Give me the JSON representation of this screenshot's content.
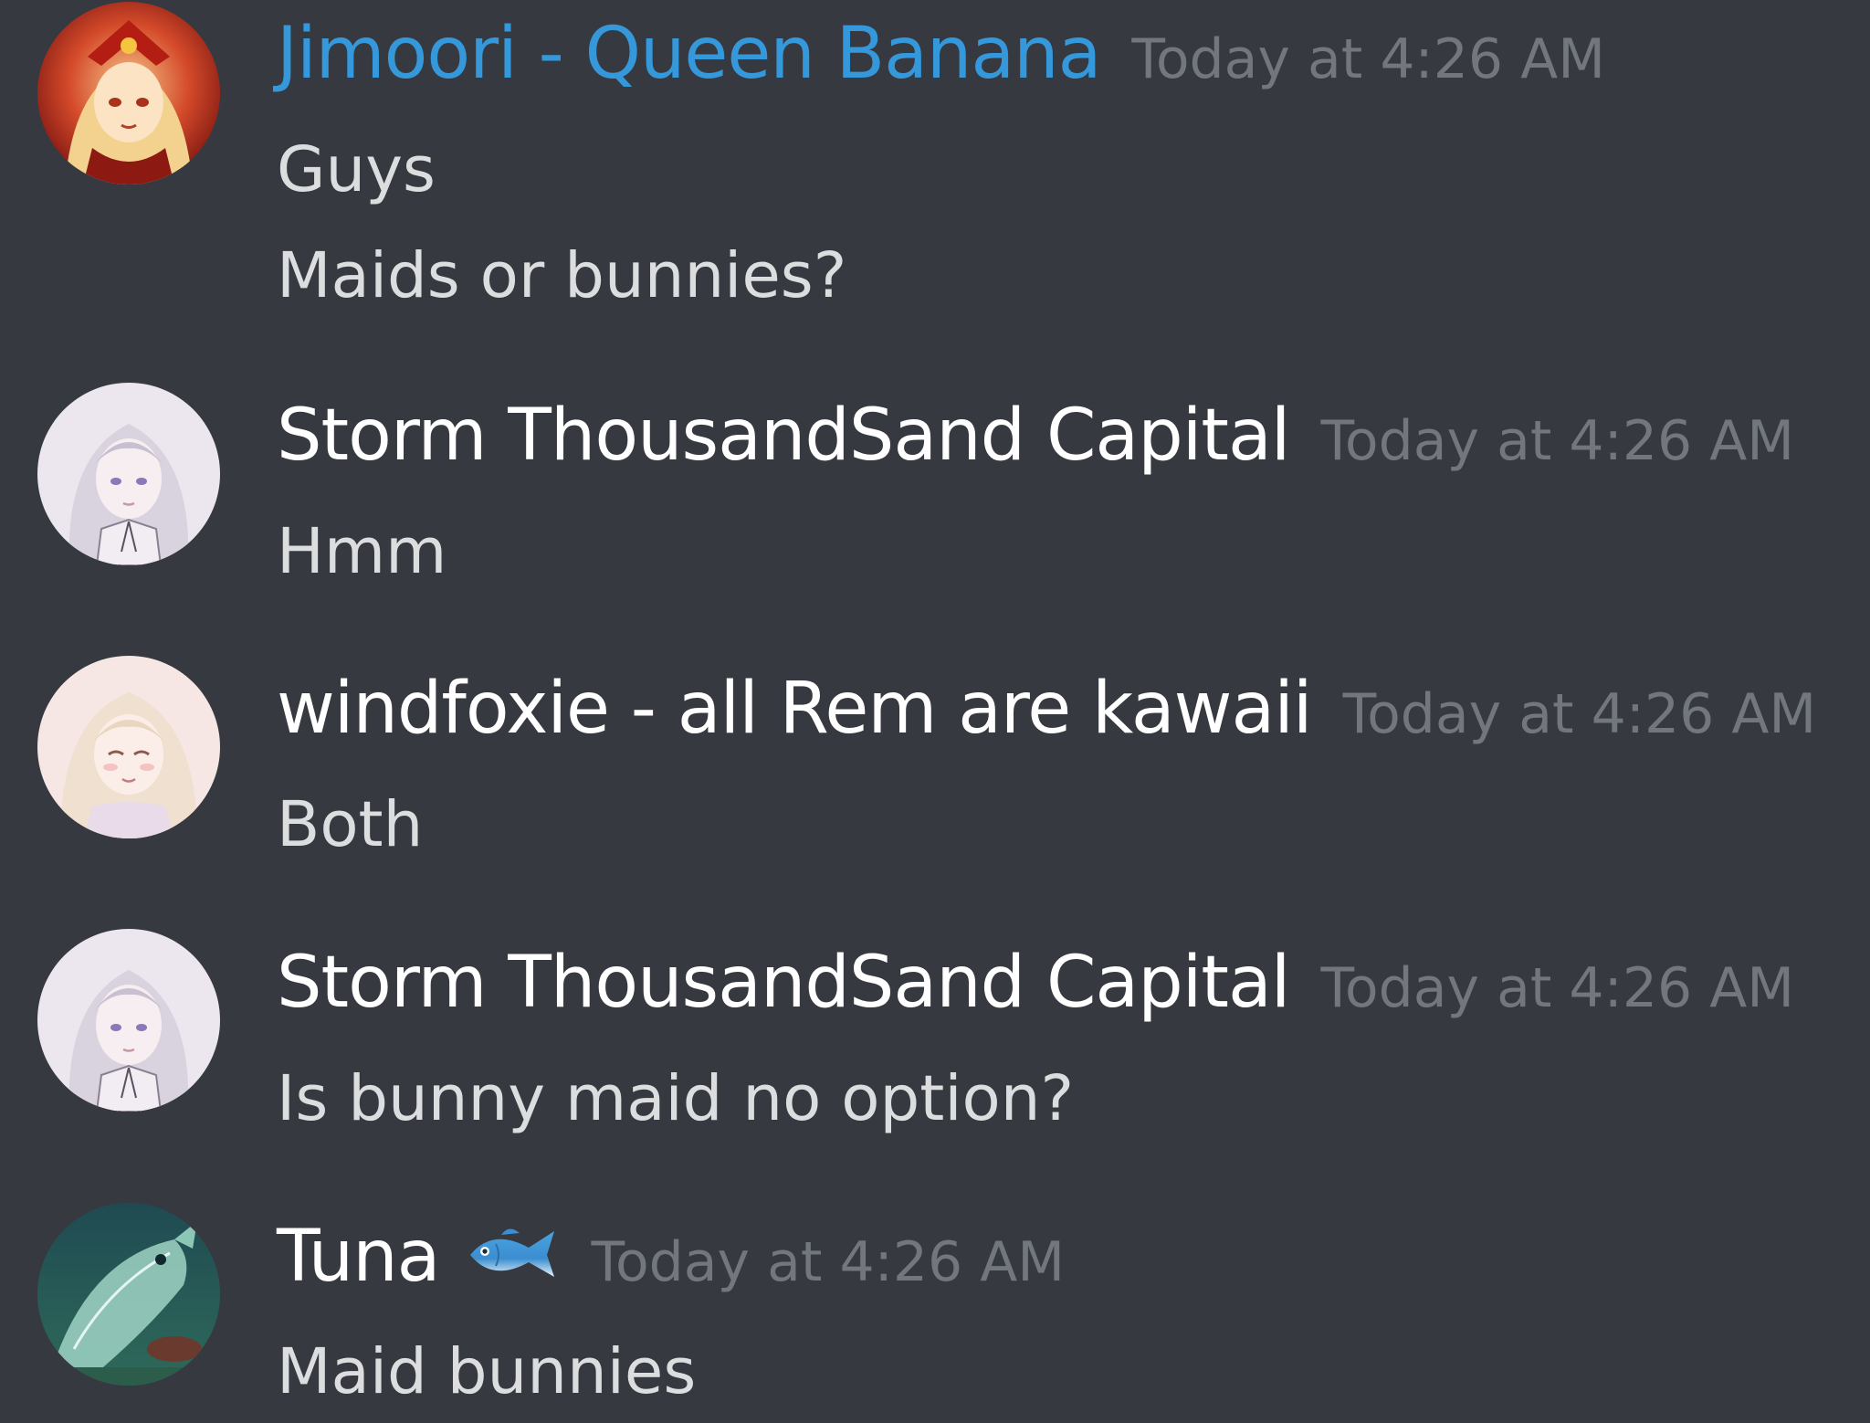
{
  "messages": [
    {
      "author": "Jimoori - Queen Banana",
      "author_color": "#3498db",
      "avatar_icon": "avatar-red-crowned-girl",
      "timestamp": "Today at 4:26 AM",
      "lines": [
        "Guys",
        "Maids or bunnies?"
      ]
    },
    {
      "author": "Storm ThousandSand Capital",
      "author_color": "#ffffff",
      "avatar_icon": "avatar-white-haired-girl",
      "timestamp": "Today at 4:26 AM",
      "lines": [
        "Hmm"
      ]
    },
    {
      "author": "windfoxie - all Rem are kawaii",
      "author_color": "#ffffff",
      "avatar_icon": "avatar-blonde-smiling-girl",
      "timestamp": "Today at 4:26 AM",
      "lines": [
        "Both"
      ]
    },
    {
      "author": "Storm ThousandSand Capital",
      "author_color": "#ffffff",
      "avatar_icon": "avatar-white-haired-girl",
      "timestamp": "Today at 4:26 AM",
      "lines": [
        "Is bunny maid no option?"
      ]
    },
    {
      "author": "Tuna",
      "author_color": "#ffffff",
      "author_emoji": "fish-emoji-icon",
      "avatar_icon": "avatar-teal-fish",
      "timestamp": "Today at 4:26 AM",
      "lines": [
        "Maid bunnies"
      ]
    }
  ],
  "colors": {
    "background": "#36393f",
    "message_text": "#dcddde",
    "timestamp": "#72767d"
  }
}
